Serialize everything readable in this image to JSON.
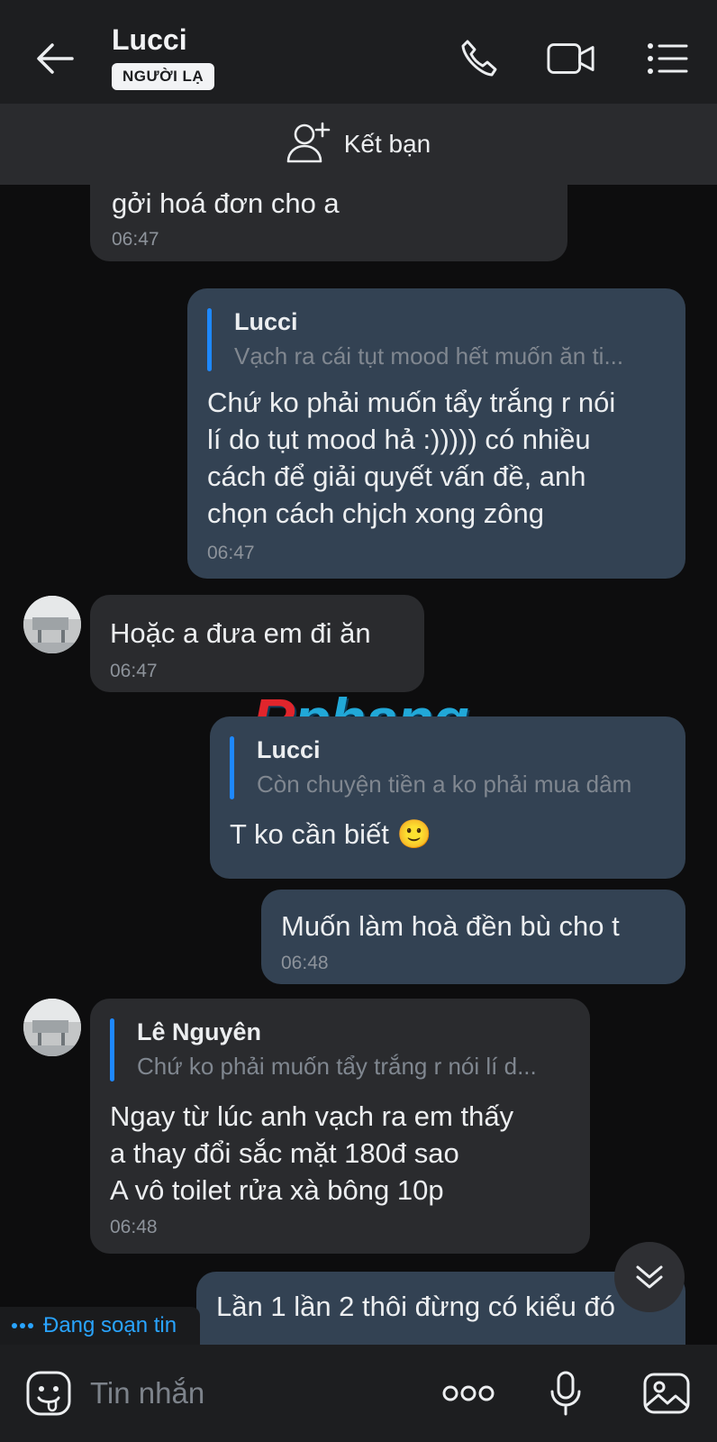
{
  "header": {
    "title": "Lucci",
    "badge": "NGƯỜI LẠ"
  },
  "add_friend": {
    "label": "Kết bạn"
  },
  "messages": [
    {
      "side": "in",
      "text": "gởi hoá đơn cho a",
      "time": "06:47"
    },
    {
      "side": "out",
      "quote": {
        "author": "Lucci",
        "text": "Vạch ra cái tụt mood hết muốn ăn ti..."
      },
      "text": "Chứ ko phải muốn tẩy trắng r nói\nlí do tụt mood hả :))))) có nhiều\ncách để giải quyết vấn đề, anh\nchọn cách chjch xong zông",
      "time": "06:47"
    },
    {
      "side": "in",
      "text": "Hoặc a đưa em đi ăn",
      "time": "06:47"
    },
    {
      "side": "out",
      "quote": {
        "author": "Lucci",
        "text": "Còn chuyện tiền a ko phải mua dâm"
      },
      "text": "T ko cần biết 🙂"
    },
    {
      "side": "out",
      "text": "Muốn làm hoà đền bù cho t",
      "time": "06:48"
    },
    {
      "side": "in",
      "quote": {
        "author": "Lê Nguyên",
        "text": "Chứ ko phải muốn tẩy trắng r nói lí d..."
      },
      "text": "Ngay từ lúc anh vạch ra em thấy\na thay đổi sắc mặt 180đ sao\nA vô toilet rửa xà bông 10p",
      "time": "06:48"
    },
    {
      "side": "out",
      "text": "Lần 1 lần 2 thôi đừng có kiểu đó"
    }
  ],
  "watermark": {
    "r": "R",
    "rest": "phang"
  },
  "typing": "Đang soạn tin",
  "input": {
    "placeholder": "Tin nhắn"
  },
  "colors": {
    "accent": "#1e88ff",
    "incoming_bubble": "#2a2b2e",
    "outgoing_bubble": "#334253",
    "background": "#0d0d0e"
  }
}
